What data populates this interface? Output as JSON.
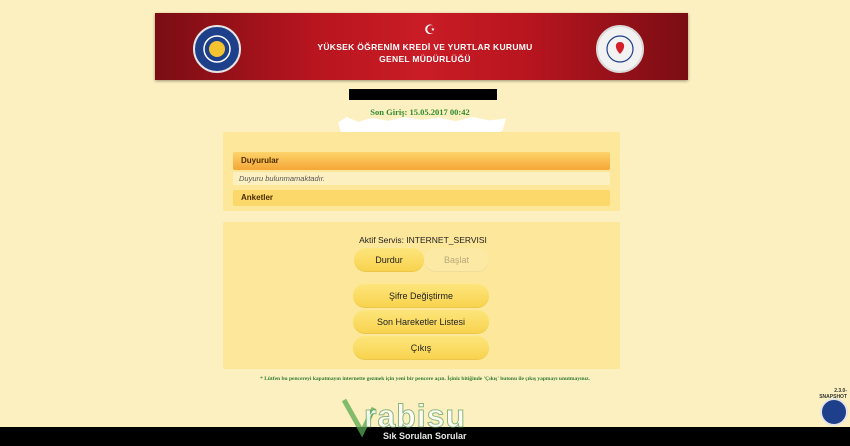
{
  "header": {
    "title_line1": "YÜKSEK ÖĞRENİM KREDİ VE YURTLAR KURUMU",
    "title_line2": "GENEL MÜDÜRLÜĞÜ"
  },
  "session": {
    "last_login": "Son Giriş: 15.05.2017 00:42"
  },
  "announcements": {
    "heading": "Duyurular",
    "empty_text": "Duyuru bulunmamaktadır."
  },
  "surveys": {
    "heading": "Anketler"
  },
  "service": {
    "label": "Aktif Servis: INTERNET_SERVISI",
    "stop_label": "Durdur",
    "start_label": "Başlat"
  },
  "menu": {
    "change_password": "Şifre Değiştirme",
    "recent_transactions": "Son Hareketler Listesi",
    "logout": "Çıkış"
  },
  "footer": {
    "note": "* Lütfen bu pencereyi kapatmayın internette gezmek için yeni bir pencere açın. İşiniz bitiğinde 'Çıkış' butonu ile çıkış yapmayı unutmayınız.",
    "version": "2.3.0-SNAPSHOT"
  },
  "watermark": {
    "brand": "rabisu",
    "subtitle": "Sık Sorulan Sorular"
  },
  "colors": {
    "background": "#fdf0c0",
    "banner_red": "#c91c26",
    "button_yellow": "#f8d24c",
    "announce_orange": "#f6a637",
    "login_green": "#2f8a2f"
  }
}
